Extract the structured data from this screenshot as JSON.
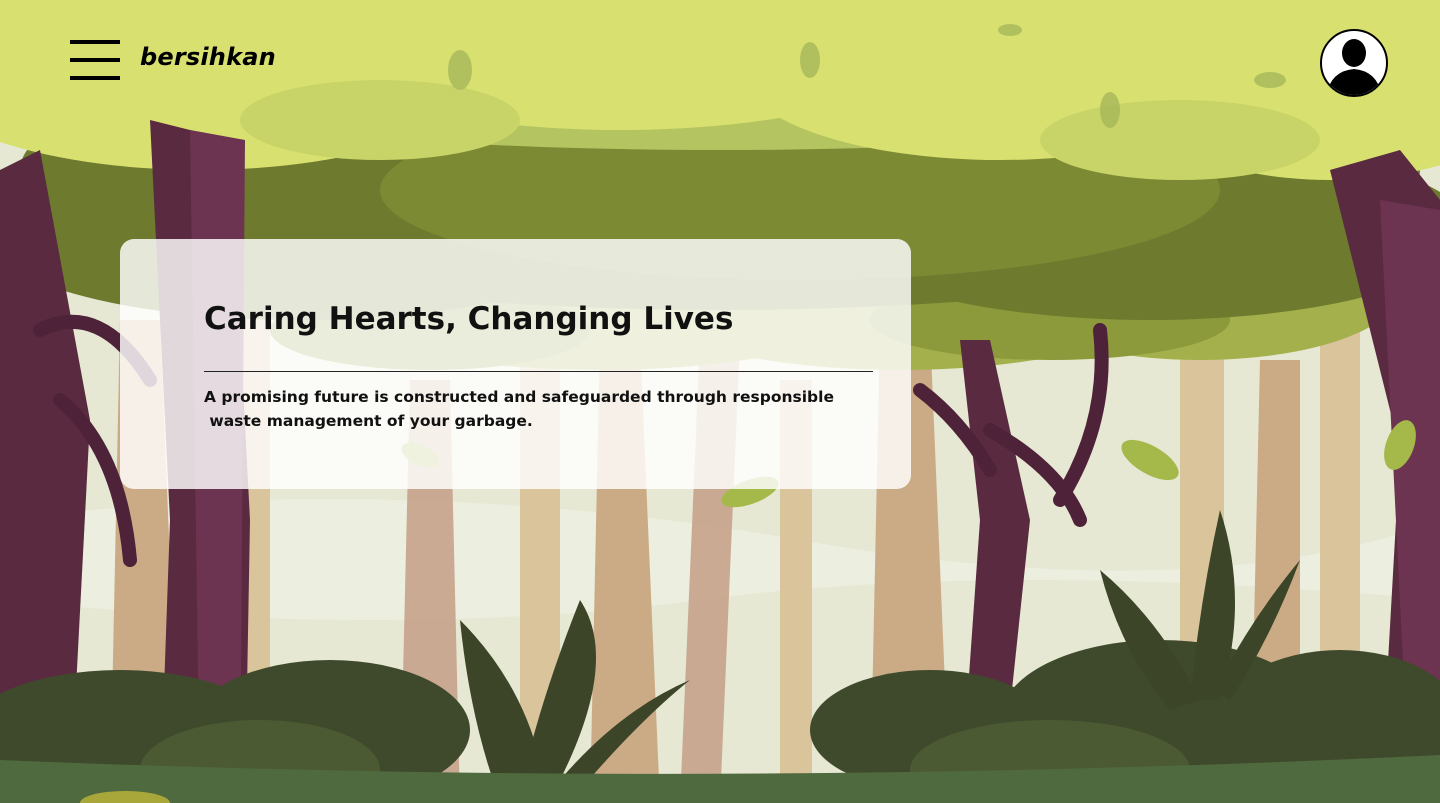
{
  "header": {
    "brand": "bersihkan",
    "menu_icon": "hamburger-menu-icon",
    "avatar_icon": "user-avatar-icon"
  },
  "hero": {
    "title": "Caring Hearts, Changing Lives",
    "description_line1": "A promising future is constructed and safeguarded through responsible",
    "description_line2": " waste management of your garbage."
  },
  "colors": {
    "canopy_light": "#d8e070",
    "canopy_mid": "#9fb04a",
    "canopy_dark": "#6e7a2e",
    "trunk_purple": "#5e2c44",
    "trunk_tan": "#d8c098",
    "bush_dark": "#3f4a2c",
    "ground": "#4f6a3e",
    "sky_mist": "#e8ead6"
  }
}
